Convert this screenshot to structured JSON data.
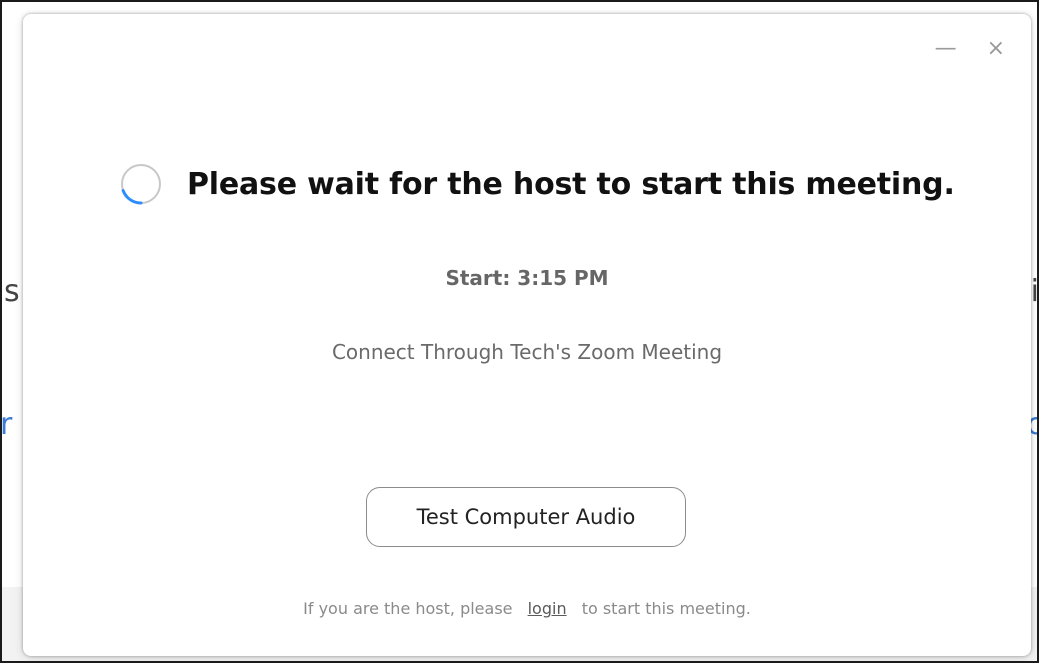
{
  "background": {
    "fragments": {
      "left_top": "s",
      "left_bottom": "r",
      "right_top": "i",
      "right_bottom": "c"
    }
  },
  "window_controls": {
    "minimize_icon": "minimize-icon",
    "minimize_glyph": "—",
    "close_icon": "close-icon",
    "close_glyph": "×"
  },
  "dialog": {
    "spinner_icon": "loading-spinner-icon",
    "headline": "Please wait for the host to start this meeting.",
    "start_time": "Start: 3:15 PM",
    "meeting_name": "Connect Through Tech's Zoom Meeting",
    "test_audio_label": "Test Computer Audio",
    "footer": {
      "prefix": "If you are the host, please",
      "link": "login",
      "suffix": "to start this meeting."
    }
  },
  "colors": {
    "spinner_track": "#c8c8c8",
    "spinner_active": "#2d8cff",
    "headline": "#111111",
    "muted_text": "#8a8a8a"
  }
}
